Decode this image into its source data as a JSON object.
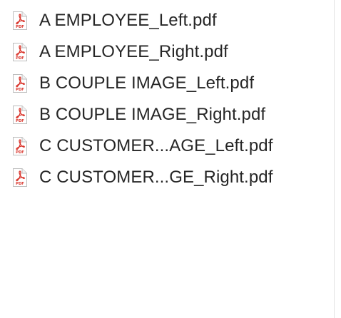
{
  "files": [
    {
      "name": "A EMPLOYEE_Left.pdf",
      "icon": "pdf-file-icon",
      "icon_label": "PDF"
    },
    {
      "name": "A EMPLOYEE_Right.pdf",
      "icon": "pdf-file-icon",
      "icon_label": "PDF"
    },
    {
      "name": "B COUPLE IMAGE_Left.pdf",
      "icon": "pdf-file-icon",
      "icon_label": "PDF"
    },
    {
      "name": "B COUPLE IMAGE_Right.pdf",
      "icon": "pdf-file-icon",
      "icon_label": "PDF"
    },
    {
      "name": "C CUSTOMER...AGE_Left.pdf",
      "icon": "pdf-file-icon",
      "icon_label": "PDF"
    },
    {
      "name": "C CUSTOMER...GE_Right.pdf",
      "icon": "pdf-file-icon",
      "icon_label": "PDF"
    }
  ],
  "colors": {
    "pdf_accent": "#d9342b",
    "text": "#262626",
    "divider": "#e3e3e3"
  }
}
